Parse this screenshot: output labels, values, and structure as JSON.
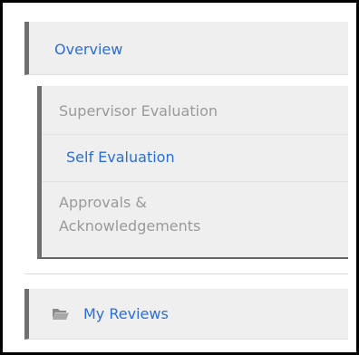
{
  "nav": {
    "overview_label": "Overview",
    "sub_items": [
      {
        "label": "Supervisor Evaluation",
        "state": "inactive"
      },
      {
        "label": "Self Evaluation",
        "state": "active"
      },
      {
        "label": "Approvals & Acknowledgements",
        "state": "inactive"
      }
    ],
    "my_reviews_label": "My Reviews",
    "my_reviews_icon": "folder-open-icon"
  },
  "colors": {
    "link_blue": "#2b6ed6",
    "inactive_gray": "#9a9a9a",
    "panel_bg": "#efefef",
    "accent_bar": "#6f6f6f"
  }
}
